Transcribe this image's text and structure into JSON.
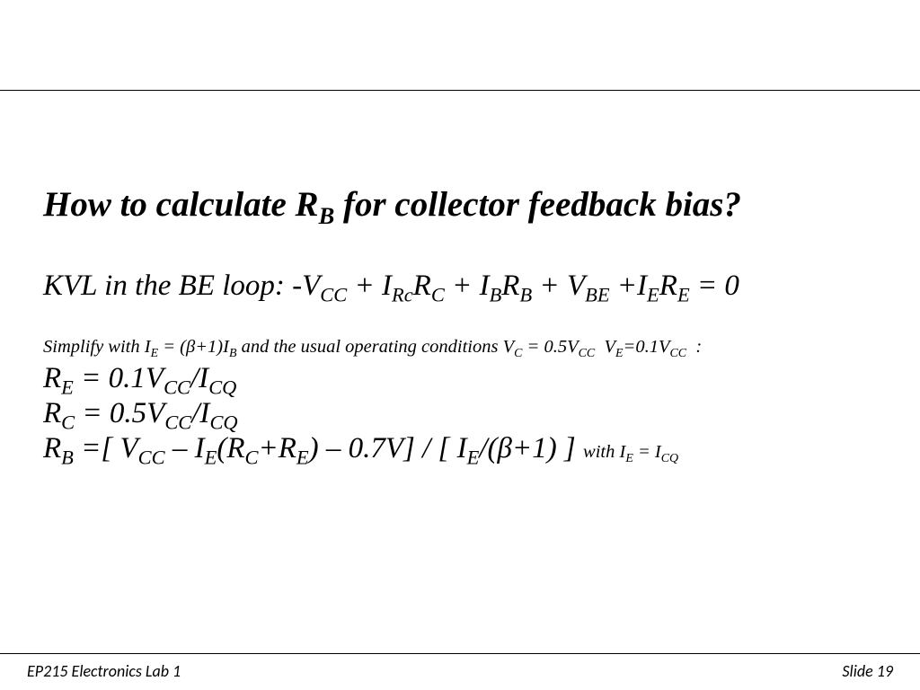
{
  "slide": {
    "title_html": "How to calculate R<sub>B</sub> for collector feedback bias?",
    "kvl_html": "KVL in the BE loop: -V<sub>CC</sub> + I<sub>Rc</sub>R<sub>C</sub> + I<sub>B</sub>R<sub>B</sub> + V<sub>BE</sub> +I<sub>E</sub>R<sub>E</sub> = 0",
    "simplify_html": "Simplify with I<sub>E</sub> = (β+1)I<sub>B</sub> and the usual operating conditions V<sub>C</sub> = 0.5V<sub>CC</sub>&nbsp; V<sub>E</sub>=0.1V<sub>CC</sub>&nbsp; :",
    "eq_re_html": "R<sub>E</sub> = 0.1V<sub>CC</sub>/I<sub>CQ</sub>",
    "eq_rc_html": "R<sub>C</sub> = 0.5V<sub>CC</sub>/I<sub>CQ</sub>",
    "eq_rb_html": "R<sub>B</sub> =[ V<sub>CC</sub> – I<sub>E</sub>(R<sub>C</sub>+R<sub>E</sub>) – 0.7V] / [ I<sub>E</sub>/(β+1) ] <span class=\"with-note\">with I<sub>E</sub> = I<sub>CQ</sub></span>"
  },
  "footer": {
    "left": "EP215 Electronics Lab 1",
    "right": "Slide 19"
  }
}
